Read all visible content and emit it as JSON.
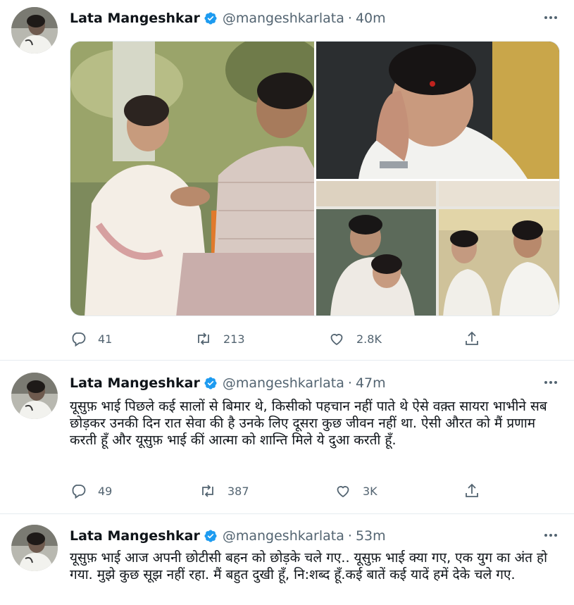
{
  "tweets": [
    {
      "name": "Lata Mangeshkar",
      "handle": "@mangeshkarlata",
      "time": "40m",
      "text": "",
      "replies": "41",
      "retweets": "213",
      "likes": "2.8K"
    },
    {
      "name": "Lata Mangeshkar",
      "handle": "@mangeshkarlata",
      "time": "47m",
      "text": "यूसुफ़ भाई पिछले कई सालों से बिमार थे, किसीको पहचान नहीं पाते थे ऐसे वक़्त सायरा भाभीने सब छोड़कर उनकी दिन रात सेवा की है उनके लिए दूसरा कुछ जीवन नहीं था. ऐसी औरत को मैं प्रणाम करती हूँ और यूसुफ़ भाई कीं आत्मा को शान्ति मिले ये दुआ करती हूँ.",
      "replies": "49",
      "retweets": "387",
      "likes": "3K"
    },
    {
      "name": "Lata Mangeshkar",
      "handle": "@mangeshkarlata",
      "time": "53m",
      "text": "यूसुफ़ भाई आज अपनी छोटीसी बहन को छोड़के चले गए.. यूसुफ़ भाई क्या गए, एक युग का अंत हो गया. मुझे कुछ सूझ नहीं रहा. मैं बहुत दुखी हूँ, नि:शब्द हूँ.कई बातें कई यादें हमें देके चले गए."
    }
  ],
  "separator": "·",
  "colors": {
    "accent": "#1d9bf0",
    "muted": "#536471",
    "text": "#0f1419",
    "border": "#e6ecf0"
  },
  "icons": [
    "verified-badge-icon",
    "more-icon",
    "reply-icon",
    "retweet-icon",
    "like-icon",
    "share-icon"
  ]
}
